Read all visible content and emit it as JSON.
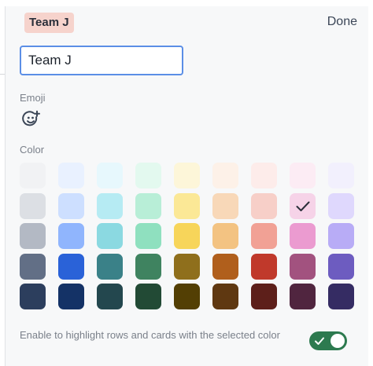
{
  "header": {
    "tag_label": "Team J",
    "done_label": "Done"
  },
  "name_field": {
    "value": "Team J"
  },
  "emoji": {
    "label": "Emoji",
    "icon": "add-emoji-icon"
  },
  "color": {
    "label": "Color",
    "selected": {
      "row": 1,
      "col": 7
    },
    "rows": [
      [
        "#f1f2f4",
        "#e9f1ff",
        "#e7f8fd",
        "#e3f9ef",
        "#fdf6d9",
        "#fdf1e8",
        "#fdecea",
        "#fcecf4",
        "#f2f0fd"
      ],
      [
        "#dcdfe4",
        "#cddfff",
        "#b6ebf3",
        "#b8eed7",
        "#fbe896",
        "#f8d8b8",
        "#f7cfc8",
        "#f6d3e8",
        "#dfd8fd"
      ],
      [
        "#b3b9c4",
        "#90b5fd",
        "#8bd9e1",
        "#8fe0bf",
        "#f7d55a",
        "#f3c382",
        "#f1a195",
        "#eb9bd0",
        "#b8acf6"
      ],
      [
        "#626f86",
        "#2a62d8",
        "#3a8188",
        "#3f8360",
        "#8f6f1c",
        "#b05f1c",
        "#c0392b",
        "#a2527f",
        "#6d5cc0"
      ],
      [
        "#2c3e5d",
        "#143266",
        "#23474e",
        "#224a35",
        "#533f04",
        "#5f3811",
        "#5d1f1a",
        "#50253f",
        "#352c63"
      ]
    ]
  },
  "highlight": {
    "text": "Enable to highlight rows and cards with the selected color",
    "enabled": true,
    "toggle_color": "#2d7a4f"
  }
}
